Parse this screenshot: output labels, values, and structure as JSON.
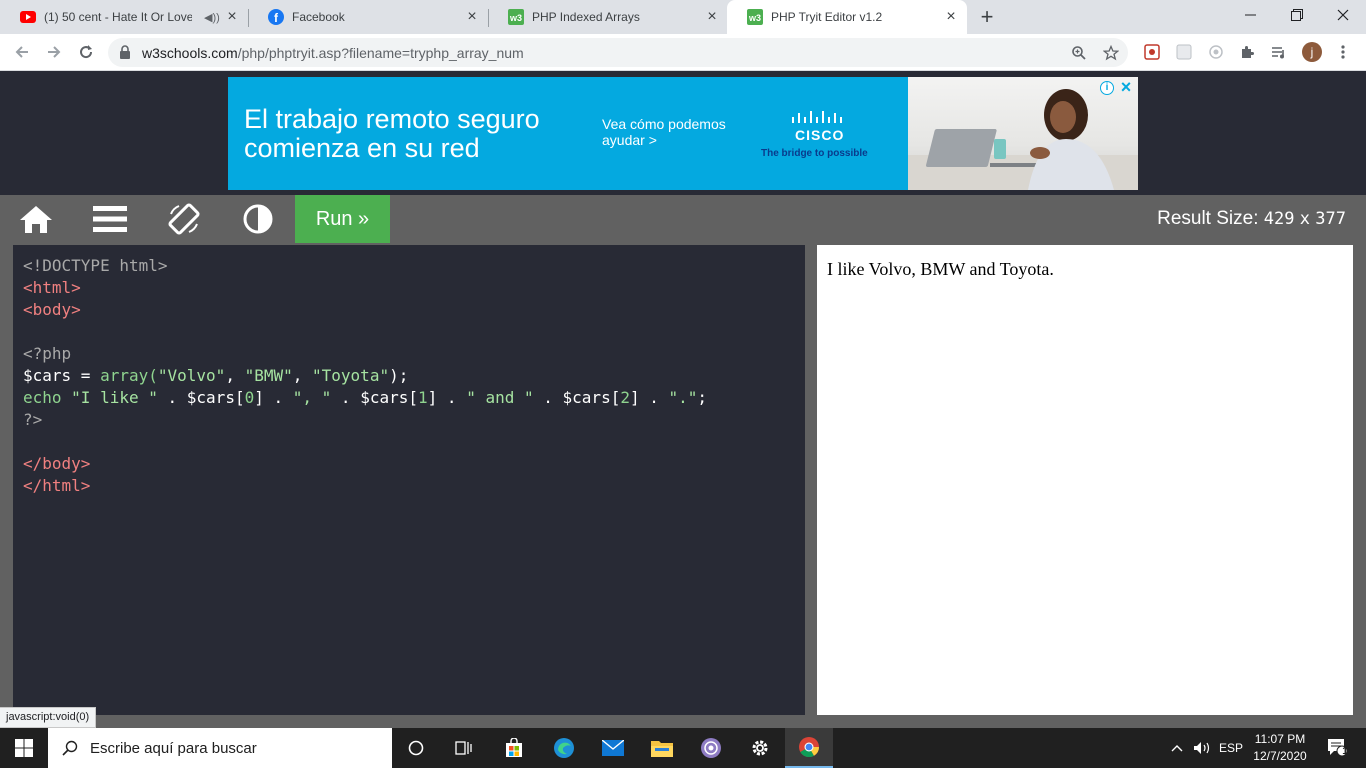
{
  "browser": {
    "tabs": [
      {
        "title": "(1) 50 cent - Hate It Or Love",
        "favicon": "youtube-icon",
        "audio": true
      },
      {
        "title": "Facebook",
        "favicon": "facebook-icon"
      },
      {
        "title": "PHP Indexed Arrays",
        "favicon": "w3schools-icon"
      },
      {
        "title": "PHP Tryit Editor v1.2",
        "favicon": "w3schools-icon",
        "active": true
      }
    ],
    "url_host": "w3schools.com",
    "url_path": "/php/phptryit.asp?filename=tryphp_array_num",
    "profile_initial": "j"
  },
  "ad": {
    "headline": "El trabajo remoto seguro comienza en su red",
    "cta": "Vea cómo podemos ayudar >",
    "brand": "CISCO",
    "tagline": "The bridge to possible"
  },
  "toolbar": {
    "run_label": "Run »",
    "result_size_label": "Result Size:",
    "result_width": "429",
    "result_x": "x",
    "result_height": "377"
  },
  "code": {
    "line1": "<!DOCTYPE html>",
    "line2": "<html>",
    "line3": "<body>",
    "line5": "<?php",
    "line6_var": "$cars",
    "line6_eq": " = ",
    "line6_fn": "array(",
    "line6_s1": "\"Volvo\"",
    "line6_c1": ", ",
    "line6_s2": "\"BMW\"",
    "line6_c2": ", ",
    "line6_s3": "\"Toyota\"",
    "line6_end": ");",
    "line7_echo": "echo ",
    "line7_s1": "\"I like \"",
    "line7_d1": " . ",
    "line7_v1": "$cars[",
    "line7_n1": "0",
    "line7_b1": "]",
    "line7_d2": " . ",
    "line7_s2": "\", \"",
    "line7_d3": " . ",
    "line7_v2": "$cars[",
    "line7_n2": "1",
    "line7_b2": "]",
    "line7_d4": " . ",
    "line7_s3": "\" and \"",
    "line7_d5": " . ",
    "line7_v3": "$cars[",
    "line7_n3": "2",
    "line7_b3": "]",
    "line7_d6": " . ",
    "line7_s4": "\".\"",
    "line7_end": ";",
    "line8": "?>",
    "line10": "</body>",
    "line11": "</html>"
  },
  "result": {
    "text": "I like Volvo, BMW and Toyota."
  },
  "status_bar": "javascript:void(0)",
  "taskbar": {
    "search_placeholder": "Escribe aquí para buscar",
    "language": "ESP",
    "time": "11:07 PM",
    "date": "12/7/2020",
    "notification_count": "1"
  },
  "colors": {
    "page_bg": "#282a35",
    "editor_bar": "#616161",
    "run_green": "#4caf50",
    "ad_blue": "#04a9e0"
  }
}
